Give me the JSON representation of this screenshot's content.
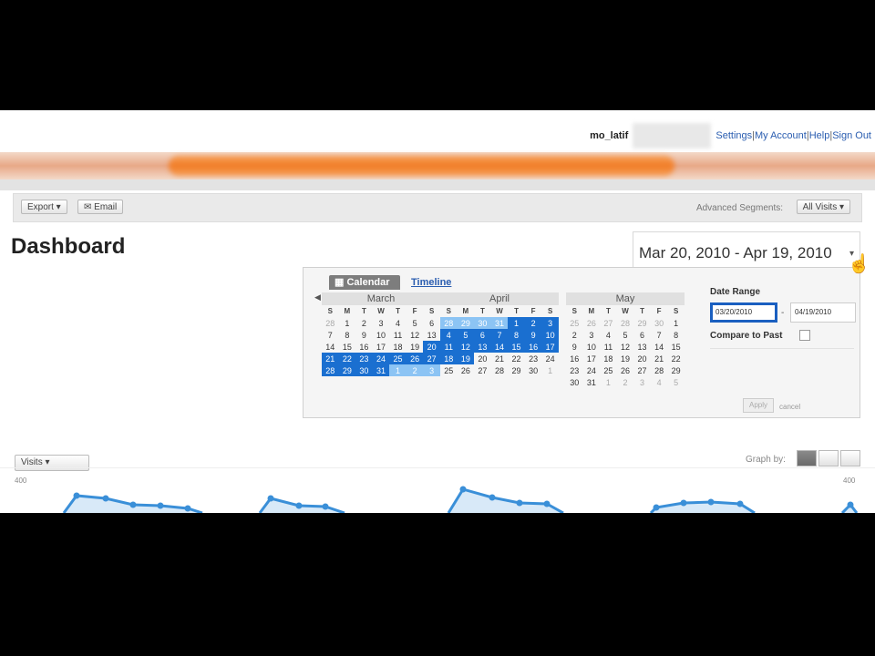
{
  "header": {
    "user": "mo_latif",
    "links": [
      "Settings",
      "My Account",
      "Help",
      "Sign Out"
    ],
    "separator": "|"
  },
  "toolbar": {
    "export_label": "Export ▾",
    "email_label": "✉ Email",
    "advanced_segments_label": "Advanced Segments:",
    "segment_value": "All Visits ▾"
  },
  "page_title": "Dashboard",
  "date_display": {
    "text": "Mar 20, 2010 - Apr 19, 2010",
    "arrow": "▾"
  },
  "calendar": {
    "tabs": {
      "calendar": "Calendar",
      "timeline": "Timeline"
    },
    "nav": {
      "prev": "◀",
      "next": "▶"
    },
    "weekdays": [
      "S",
      "M",
      "T",
      "W",
      "T",
      "F",
      "S"
    ],
    "months": [
      {
        "name": "March",
        "weeks": [
          [
            "28",
            "1",
            "2",
            "3",
            "4",
            "5",
            "6"
          ],
          [
            "7",
            "8",
            "9",
            "10",
            "11",
            "12",
            "13"
          ],
          [
            "14",
            "15",
            "16",
            "17",
            "18",
            "19",
            "20"
          ],
          [
            "21",
            "22",
            "23",
            "24",
            "25",
            "26",
            "27"
          ],
          [
            "28",
            "29",
            "30",
            "31",
            "1",
            "2",
            "3"
          ]
        ]
      },
      {
        "name": "April",
        "weeks": [
          [
            "28",
            "29",
            "30",
            "31",
            "1",
            "2",
            "3"
          ],
          [
            "4",
            "5",
            "6",
            "7",
            "8",
            "9",
            "10"
          ],
          [
            "11",
            "12",
            "13",
            "14",
            "15",
            "16",
            "17"
          ],
          [
            "18",
            "19",
            "20",
            "21",
            "22",
            "23",
            "24"
          ],
          [
            "25",
            "26",
            "27",
            "28",
            "29",
            "30",
            "1"
          ]
        ]
      },
      {
        "name": "May",
        "weeks": [
          [
            "25",
            "26",
            "27",
            "28",
            "29",
            "30",
            "1"
          ],
          [
            "2",
            "3",
            "4",
            "5",
            "6",
            "7",
            "8"
          ],
          [
            "9",
            "10",
            "11",
            "12",
            "13",
            "14",
            "15"
          ],
          [
            "16",
            "17",
            "18",
            "19",
            "20",
            "21",
            "22"
          ],
          [
            "23",
            "24",
            "25",
            "26",
            "27",
            "28",
            "29"
          ],
          [
            "30",
            "31",
            "1",
            "2",
            "3",
            "4",
            "5"
          ]
        ]
      }
    ],
    "date_range_label": "Date Range",
    "start_date": "03/20/2010",
    "range_dash": "-",
    "end_date": "04/19/2010",
    "compare_label": "Compare to Past",
    "apply_label": "Apply",
    "cancel_label": "cancel",
    "selection_color": "#1a6fd0"
  },
  "graph": {
    "metric_label": "Visits ▾",
    "graph_by_label": "Graph by:",
    "y_max_left": "400",
    "y_max_right": "400",
    "line_color": "#3a8fd8"
  }
}
